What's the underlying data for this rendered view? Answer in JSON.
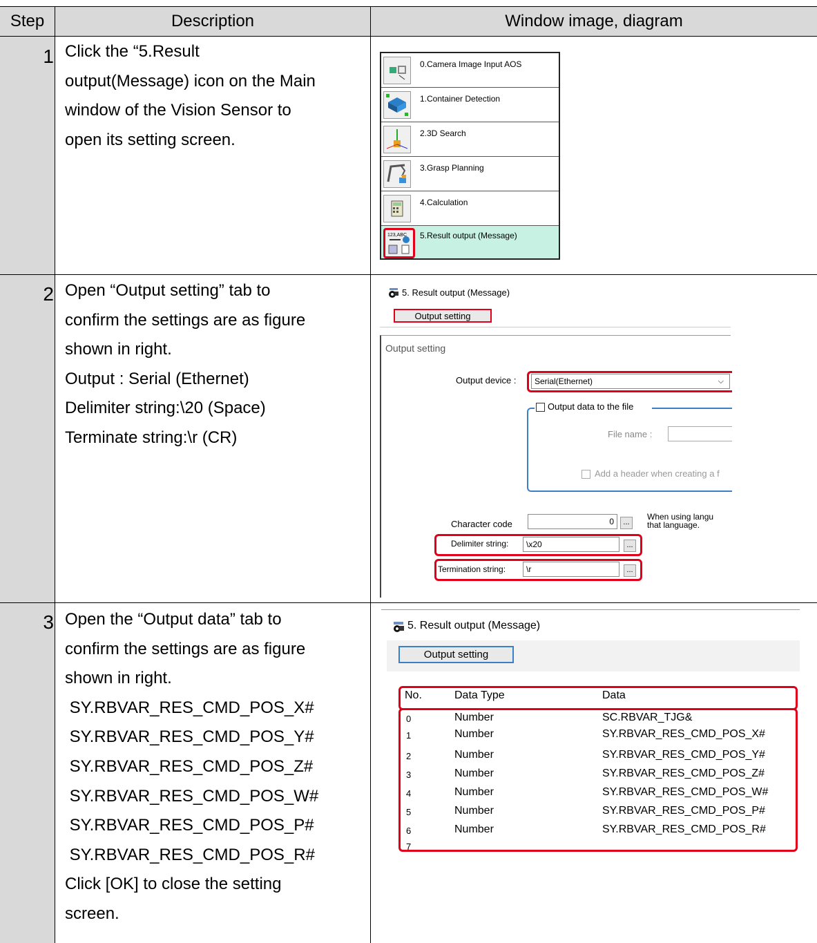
{
  "headers": {
    "step": "Step",
    "description": "Description",
    "window": "Window image, diagram"
  },
  "rows": [
    {
      "step": "1",
      "lines": [
        "Click the “5.Result",
        "output(Message) icon on the Main",
        "window of the Vision Sensor to",
        "open its setting screen."
      ]
    },
    {
      "step": "2",
      "lines": [
        "Open “Output setting” tab to",
        "confirm the settings are as figure",
        "shown in right.",
        "Output : Serial (Ethernet)",
        "Delimiter string:\\20 (Space)",
        "Terminate string:\\r (CR)"
      ]
    },
    {
      "step": "3",
      "lines": [
        "Open the “Output data” tab to",
        "confirm the settings are as figure",
        "shown in right.",
        " SY.RBVAR_RES_CMD_POS_X#",
        " SY.RBVAR_RES_CMD_POS_Y#",
        " SY.RBVAR_RES_CMD_POS_Z#",
        " SY.RBVAR_RES_CMD_POS_W#",
        " SY.RBVAR_RES_CMD_POS_P#",
        " SY.RBVAR_RES_CMD_POS_R#",
        "Click [OK] to close the setting",
        "screen."
      ]
    }
  ],
  "tools": [
    {
      "label": "0.Camera Image Input AOS",
      "icon": "camera-input-icon"
    },
    {
      "label": "1.Container Detection",
      "icon": "container-detection-icon"
    },
    {
      "label": "2.3D Search",
      "icon": "3d-search-icon"
    },
    {
      "label": "3.Grasp Planning",
      "icon": "grasp-planning-icon"
    },
    {
      "label": "4.Calculation",
      "icon": "calculator-icon"
    },
    {
      "label": "5.Result output (Message)",
      "icon": "result-output-icon",
      "icon_text": "123,ABC"
    }
  ],
  "step2": {
    "title": "5. Result output (Message)",
    "tab": "Output setting",
    "group": "Output setting",
    "output_device_label": "Output device :",
    "output_device_value": "Serial(Ethernet)",
    "file_checkbox_label": "Output data to the file",
    "file_name_label": "File name :",
    "header_checkbox_label": "Add a header when creating a f",
    "char_code_label": "Character code",
    "char_code_value": "0",
    "note_line1": "When using langu",
    "note_line2": "that language.",
    "delimiter_label": "Delimiter string:",
    "delimiter_value": "\\x20",
    "termination_label": "Termination string:",
    "termination_value": "\\r",
    "button_dots": "..."
  },
  "step3": {
    "title": "5. Result output (Message)",
    "tab": "Output setting",
    "columns": [
      "No.",
      "Data Type",
      "Data"
    ],
    "rows": [
      {
        "no": "0",
        "type": "Number",
        "data": "SC.RBVAR_TJG&"
      },
      {
        "no": "1",
        "type": "Number",
        "data": "SY.RBVAR_RES_CMD_POS_X#"
      },
      {
        "no": "2",
        "type": "Number",
        "data": "SY.RBVAR_RES_CMD_POS_Y#"
      },
      {
        "no": "3",
        "type": "Number",
        "data": "SY.RBVAR_RES_CMD_POS_Z#"
      },
      {
        "no": "4",
        "type": "Number",
        "data": "SY.RBVAR_RES_CMD_POS_W#"
      },
      {
        "no": "5",
        "type": "Number",
        "data": "SY.RBVAR_RES_CMD_POS_P#"
      },
      {
        "no": "6",
        "type": "Number",
        "data": "SY.RBVAR_RES_CMD_POS_R#"
      },
      {
        "no": "7",
        "type": "",
        "data": ""
      }
    ]
  },
  "colors": {
    "header_bg": "#d9d9d9",
    "highlight_red": "#e0001a",
    "selected_row": "#c6f1e3",
    "tab_border": "#3b7fc7"
  }
}
